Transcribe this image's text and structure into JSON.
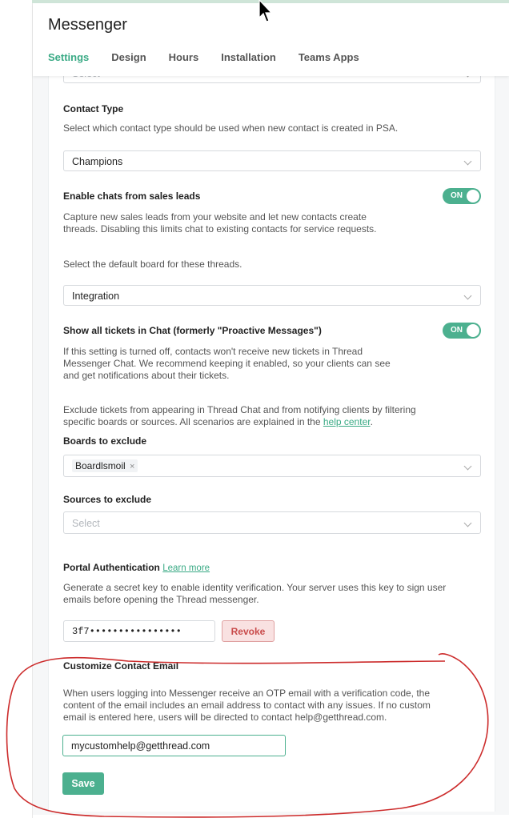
{
  "app": {
    "title": "Messenger"
  },
  "tabs": [
    {
      "label": "Settings"
    },
    {
      "label": "Design"
    },
    {
      "label": "Hours"
    },
    {
      "label": "Installation"
    },
    {
      "label": "Teams Apps"
    }
  ],
  "top_select": {
    "placeholder": "Select"
  },
  "contact_type": {
    "label": "Contact Type",
    "description": "Select which contact type should be used when new contact is created in PSA.",
    "value": "Champions"
  },
  "sales_leads": {
    "label": "Enable chats from sales leads",
    "toggle": "ON",
    "description_line1": "Capture new sales leads from your website and let new contacts create",
    "description_line2": "threads. Disabling this limits chat to existing contacts for service requests.",
    "board_prompt": "Select the default board for these threads.",
    "board_value": "Integration"
  },
  "show_tickets": {
    "label": "Show all tickets in Chat (formerly \"Proactive Messages\")",
    "toggle": "ON",
    "description_line1": "If this setting is turned off, contacts won't receive new tickets in Thread",
    "description_line2": "Messenger Chat. We recommend keeping it enabled, so your clients can see",
    "description_line3": "and get notifications about their tickets.",
    "exclude_line1": "Exclude tickets from appearing in Thread Chat and from notifying clients by filtering",
    "exclude_line2": "specific boards or sources. All scenarios are explained in the",
    "help_link": "help center",
    "period": ".",
    "boards_label": "Boards to exclude",
    "board_tag": "Boardlsmoil",
    "tag_remove": "×",
    "sources_label": "Sources to exclude",
    "sources_placeholder": "Select"
  },
  "portal_auth": {
    "label": "Portal Authentication",
    "learn_more": "Learn more",
    "description_line1": "Generate a secret key to enable identity verification. Your server uses this key to sign user",
    "description_line2": "emails before opening the Thread messenger.",
    "key_value": "3f7••••••••••••••••",
    "revoke_label": "Revoke"
  },
  "contact_email": {
    "label": "Customize Contact Email",
    "description_line1": "When users logging into Messenger receive an OTP email with a verification code, the",
    "description_line2": "content of the email includes an email address to contact with any issues. If no custom",
    "description_line3": "email is entered here, users will be directed to contact help@getthread.com.",
    "input_value": "mycustomhelp@getthread.com",
    "save_label": "Save"
  },
  "colors": {
    "accent": "#4cb08f",
    "annotation": "#cc2b2b",
    "revoke": "#c94b4b"
  },
  "icons": {
    "cursor": "mouse-pointer-icon",
    "chevron": "chevron-down-icon"
  }
}
